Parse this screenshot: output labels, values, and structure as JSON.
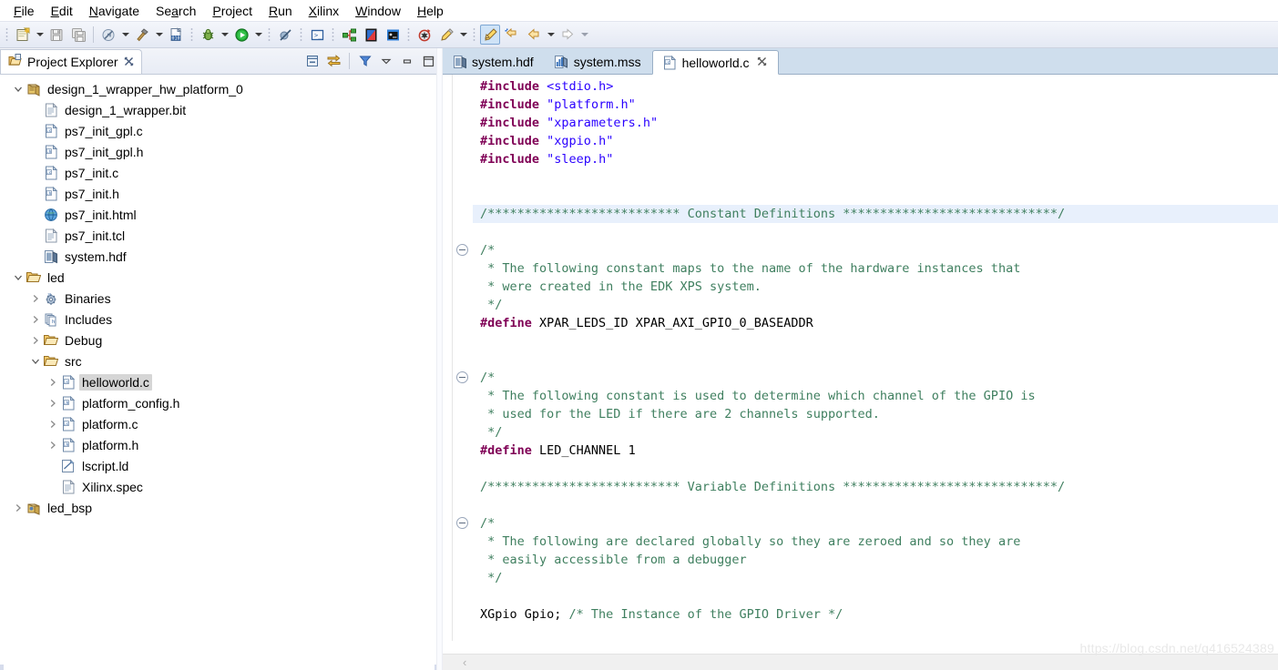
{
  "menu": {
    "items": [
      {
        "label": "File",
        "mnemonic": "F"
      },
      {
        "label": "Edit",
        "mnemonic": "E"
      },
      {
        "label": "Navigate",
        "mnemonic": "N"
      },
      {
        "label": "Search",
        "mnemonic": "a"
      },
      {
        "label": "Project",
        "mnemonic": "P"
      },
      {
        "label": "Run",
        "mnemonic": "R"
      },
      {
        "label": "Xilinx",
        "mnemonic": "X"
      },
      {
        "label": "Window",
        "mnemonic": "W"
      },
      {
        "label": "Help",
        "mnemonic": "H"
      }
    ]
  },
  "toolbar": {
    "buttons": [
      {
        "name": "new-icon",
        "tooltip": "New"
      },
      {
        "name": "save-icon",
        "tooltip": "Save"
      },
      {
        "name": "save-all-icon",
        "tooltip": "Save All"
      },
      {
        "name": "build-disabled-icon",
        "tooltip": "Build"
      },
      {
        "name": "hammer-build-icon",
        "tooltip": "Build Project"
      },
      {
        "name": "binary-010-icon",
        "tooltip": "Program FPGA"
      },
      {
        "name": "debug-bug-icon",
        "tooltip": "Debug"
      },
      {
        "name": "run-play-icon",
        "tooltip": "Run"
      },
      {
        "name": "skip-breakpoints-icon",
        "tooltip": "Skip All Breakpoints"
      },
      {
        "name": "terminal-icon",
        "tooltip": "SDK Terminal"
      },
      {
        "name": "hardware-manager-icon",
        "tooltip": "Program FPGA"
      },
      {
        "name": "vivado-icon",
        "tooltip": "Launch Vivado"
      },
      {
        "name": "dump-console-icon",
        "tooltip": "XSCT Console"
      },
      {
        "name": "regenerate-bsp-icon",
        "tooltip": "Regenerate BSP Sources"
      },
      {
        "name": "pen-annotate-icon",
        "tooltip": "Annotate"
      },
      {
        "name": "highlight-pen-icon",
        "tooltip": "Highlighter",
        "selected": true
      },
      {
        "name": "back-history-icon",
        "tooltip": "Back"
      },
      {
        "name": "back-arrow-icon",
        "tooltip": "Previous Annotation"
      },
      {
        "name": "forward-arrow-icon",
        "tooltip": "Next Annotation"
      }
    ]
  },
  "project_explorer": {
    "title": "Project Explorer",
    "close_glyph": "✕",
    "tools": [
      {
        "name": "collapse-all-icon"
      },
      {
        "name": "link-with-editor-icon"
      },
      {
        "name": "view-menu-filter-icon"
      },
      {
        "name": "view-menu-icon"
      },
      {
        "name": "minimize-view-icon"
      },
      {
        "name": "maximize-view-icon"
      }
    ],
    "tree": [
      {
        "label": "design_1_wrapper_hw_platform_0",
        "indent": 0,
        "twisty": "expanded",
        "icon": "hw-platform-icon",
        "selected": false
      },
      {
        "label": "design_1_wrapper.bit",
        "indent": 1,
        "twisty": "none",
        "icon": "file-icon",
        "selected": false
      },
      {
        "label": "ps7_init_gpl.c",
        "indent": 1,
        "twisty": "none",
        "icon": "c-file-icon",
        "selected": false
      },
      {
        "label": "ps7_init_gpl.h",
        "indent": 1,
        "twisty": "none",
        "icon": "h-file-icon",
        "selected": false
      },
      {
        "label": "ps7_init.c",
        "indent": 1,
        "twisty": "none",
        "icon": "c-file-icon",
        "selected": false
      },
      {
        "label": "ps7_init.h",
        "indent": 1,
        "twisty": "none",
        "icon": "h-file-icon",
        "selected": false
      },
      {
        "label": "ps7_init.html",
        "indent": 1,
        "twisty": "none",
        "icon": "html-file-icon",
        "selected": false
      },
      {
        "label": "ps7_init.tcl",
        "indent": 1,
        "twisty": "none",
        "icon": "file-icon",
        "selected": false
      },
      {
        "label": "system.hdf",
        "indent": 1,
        "twisty": "none",
        "icon": "hdf-file-icon",
        "selected": false
      },
      {
        "label": "led",
        "indent": 0,
        "twisty": "expanded",
        "icon": "folder-open-icon",
        "selected": false
      },
      {
        "label": "Binaries",
        "indent": 1,
        "twisty": "collapsed",
        "icon": "binaries-icon",
        "selected": false
      },
      {
        "label": "Includes",
        "indent": 1,
        "twisty": "collapsed",
        "icon": "includes-icon",
        "selected": false
      },
      {
        "label": "Debug",
        "indent": 1,
        "twisty": "collapsed",
        "icon": "folder-open-icon",
        "selected": false
      },
      {
        "label": "src",
        "indent": 1,
        "twisty": "expanded",
        "icon": "folder-open-icon",
        "selected": false
      },
      {
        "label": "helloworld.c",
        "indent": 2,
        "twisty": "collapsed",
        "icon": "c-file-icon",
        "selected": true
      },
      {
        "label": "platform_config.h",
        "indent": 2,
        "twisty": "collapsed",
        "icon": "h-file-icon",
        "selected": false
      },
      {
        "label": "platform.c",
        "indent": 2,
        "twisty": "collapsed",
        "icon": "c-file-icon",
        "selected": false
      },
      {
        "label": "platform.h",
        "indent": 2,
        "twisty": "collapsed",
        "icon": "h-file-icon",
        "selected": false
      },
      {
        "label": "lscript.ld",
        "indent": 2,
        "twisty": "none",
        "icon": "linker-script-icon",
        "selected": false
      },
      {
        "label": "Xilinx.spec",
        "indent": 2,
        "twisty": "none",
        "icon": "file-icon",
        "selected": false
      },
      {
        "label": "led_bsp",
        "indent": 0,
        "twisty": "collapsed",
        "icon": "bsp-icon",
        "selected": false
      }
    ]
  },
  "editor": {
    "tabs": [
      {
        "label": "system.hdf",
        "icon": "hdf-file-icon",
        "active": false,
        "closable": false
      },
      {
        "label": "system.mss",
        "icon": "mss-file-icon",
        "active": false,
        "closable": false
      },
      {
        "label": "helloworld.c",
        "icon": "c-file-icon",
        "active": true,
        "closable": true,
        "close_glyph": "✕"
      }
    ],
    "scroll_left_glyph": "‹",
    "code_lines": [
      {
        "highlight": false,
        "fold": false,
        "tokens": [
          {
            "t": "#include",
            "c": "pp"
          },
          {
            "t": " ",
            "c": "pl"
          },
          {
            "t": "<stdio.h>",
            "c": "str"
          }
        ]
      },
      {
        "highlight": false,
        "fold": false,
        "tokens": [
          {
            "t": "#include",
            "c": "pp"
          },
          {
            "t": " ",
            "c": "pl"
          },
          {
            "t": "\"platform.h\"",
            "c": "str"
          }
        ]
      },
      {
        "highlight": false,
        "fold": false,
        "tokens": [
          {
            "t": "#include",
            "c": "pp"
          },
          {
            "t": " ",
            "c": "pl"
          },
          {
            "t": "\"xparameters.h\"",
            "c": "str"
          }
        ]
      },
      {
        "highlight": false,
        "fold": false,
        "tokens": [
          {
            "t": "#include",
            "c": "pp"
          },
          {
            "t": " ",
            "c": "pl"
          },
          {
            "t": "\"xgpio.h\"",
            "c": "str"
          }
        ]
      },
      {
        "highlight": false,
        "fold": false,
        "tokens": [
          {
            "t": "#include",
            "c": "pp"
          },
          {
            "t": " ",
            "c": "pl"
          },
          {
            "t": "\"sleep.h\"",
            "c": "str"
          }
        ]
      },
      {
        "highlight": false,
        "fold": false,
        "tokens": []
      },
      {
        "highlight": false,
        "fold": false,
        "tokens": []
      },
      {
        "highlight": true,
        "fold": false,
        "tokens": [
          {
            "t": "/************************** Constant Definitions *****************************/",
            "c": "cm"
          }
        ]
      },
      {
        "highlight": false,
        "fold": false,
        "tokens": []
      },
      {
        "highlight": false,
        "fold": true,
        "tokens": [
          {
            "t": "/*",
            "c": "cm"
          }
        ]
      },
      {
        "highlight": false,
        "fold": false,
        "tokens": [
          {
            "t": " * The following constant maps to the name of the hardware instances that",
            "c": "cm"
          }
        ]
      },
      {
        "highlight": false,
        "fold": false,
        "tokens": [
          {
            "t": " * were created in the EDK XPS system.",
            "c": "cm"
          }
        ]
      },
      {
        "highlight": false,
        "fold": false,
        "tokens": [
          {
            "t": " */",
            "c": "cm"
          }
        ]
      },
      {
        "highlight": false,
        "fold": false,
        "tokens": [
          {
            "t": "#define",
            "c": "pp"
          },
          {
            "t": " XPAR_LEDS_ID XPAR_AXI_GPIO_0_BASEADDR",
            "c": "pl"
          }
        ]
      },
      {
        "highlight": false,
        "fold": false,
        "tokens": []
      },
      {
        "highlight": false,
        "fold": false,
        "tokens": []
      },
      {
        "highlight": false,
        "fold": true,
        "tokens": [
          {
            "t": "/*",
            "c": "cm"
          }
        ]
      },
      {
        "highlight": false,
        "fold": false,
        "tokens": [
          {
            "t": " * The following constant is used to determine which channel of the GPIO is",
            "c": "cm"
          }
        ]
      },
      {
        "highlight": false,
        "fold": false,
        "tokens": [
          {
            "t": " * used for the LED if there are 2 channels supported.",
            "c": "cm"
          }
        ]
      },
      {
        "highlight": false,
        "fold": false,
        "tokens": [
          {
            "t": " */",
            "c": "cm"
          }
        ]
      },
      {
        "highlight": false,
        "fold": false,
        "tokens": [
          {
            "t": "#define",
            "c": "pp"
          },
          {
            "t": " LED_CHANNEL 1",
            "c": "pl"
          }
        ]
      },
      {
        "highlight": false,
        "fold": false,
        "tokens": []
      },
      {
        "highlight": false,
        "fold": false,
        "tokens": [
          {
            "t": "/************************** Variable Definitions *****************************/",
            "c": "cm"
          }
        ]
      },
      {
        "highlight": false,
        "fold": false,
        "tokens": []
      },
      {
        "highlight": false,
        "fold": true,
        "tokens": [
          {
            "t": "/*",
            "c": "cm"
          }
        ]
      },
      {
        "highlight": false,
        "fold": false,
        "tokens": [
          {
            "t": " * The following are declared globally so they are zeroed and so they are",
            "c": "cm"
          }
        ]
      },
      {
        "highlight": false,
        "fold": false,
        "tokens": [
          {
            "t": " * easily accessible from a debugger",
            "c": "cm"
          }
        ]
      },
      {
        "highlight": false,
        "fold": false,
        "tokens": [
          {
            "t": " */",
            "c": "cm"
          }
        ]
      },
      {
        "highlight": false,
        "fold": false,
        "tokens": []
      },
      {
        "highlight": false,
        "fold": false,
        "tokens": [
          {
            "t": "XGpio Gpio; ",
            "c": "pl"
          },
          {
            "t": "/* The Instance of the GPIO Driver */",
            "c": "cm"
          }
        ]
      }
    ]
  },
  "watermark": {
    "text": "https://blog.csdn.net/q416524389"
  },
  "colors": {
    "tab_bar": "#cfdeed",
    "selection": "#d6d6d6",
    "line_highlight": "#e8f0fc",
    "comment": "#3f7f5f",
    "preprocessor": "#7f0055",
    "string": "#2a00ff"
  }
}
